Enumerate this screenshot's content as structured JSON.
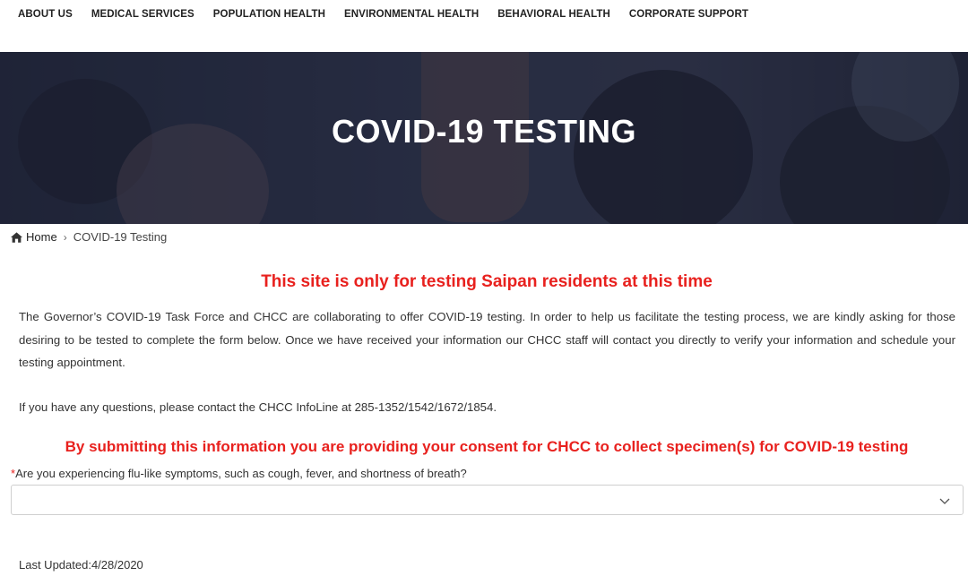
{
  "nav": {
    "items": [
      "ABOUT US",
      "MEDICAL SERVICES",
      "POPULATION HEALTH",
      "ENVIRONMENTAL HEALTH",
      "BEHAVIORAL HEALTH",
      "CORPORATE SUPPORT"
    ]
  },
  "hero": {
    "title": "COVID-19 TESTING"
  },
  "breadcrumb": {
    "home": "Home",
    "separator": "›",
    "current": "COVID-19 Testing"
  },
  "notice_top": "This site is only for testing Saipan residents at this time",
  "intro": "The Governor’s COVID-19 Task Force and CHCC are collaborating to offer COVID-19 testing. In order to help us facilitate the testing process, we are kindly asking for those desiring to be tested to complete the form below. Once we have received your information our CHCC staff will contact you directly to verify your information and schedule your testing appointment.",
  "contact": "If you have any questions, please contact the CHCC InfoLine at 285-1352/1542/1672/1854.",
  "consent": "By submitting this information you are providing your consent for CHCC to collect specimen(s) for COVID-19 testing",
  "form": {
    "required_marker": "*",
    "question": "Are you experiencing flu-like symptoms, such as cough, fever, and shortness of breath?",
    "selected": ""
  },
  "footer": {
    "last_updated": "Last Updated:4/28/2020"
  },
  "colors": {
    "accent_red": "#e8211e",
    "hero_overlay": "#1e243c"
  },
  "icons": {
    "home": "home-icon",
    "dropdown": "chevron-down-icon"
  }
}
